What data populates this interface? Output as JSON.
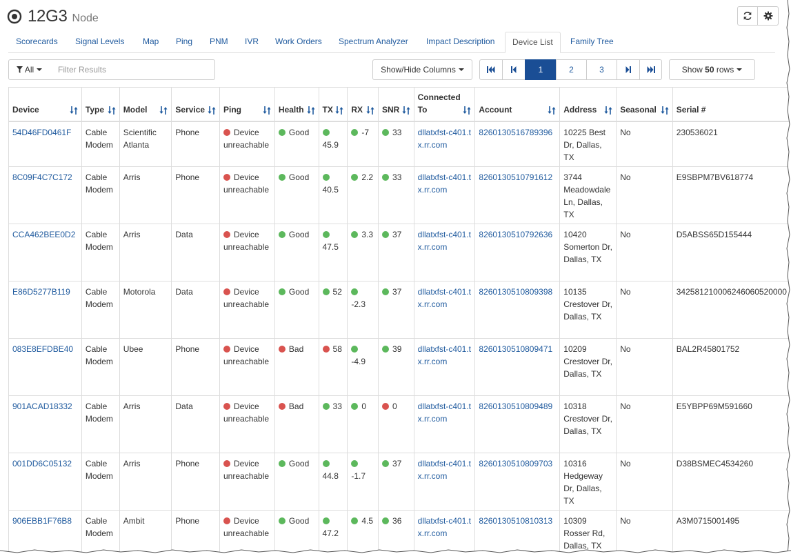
{
  "header": {
    "node_id": "12G3",
    "node_type": "Node",
    "icons": {
      "target": "target-icon",
      "refresh": "refresh-icon",
      "settings": "gear-icon"
    }
  },
  "tabs": [
    {
      "label": "Scorecards"
    },
    {
      "label": "Signal Levels"
    },
    {
      "label": "Map"
    },
    {
      "label": "Ping"
    },
    {
      "label": "PNM"
    },
    {
      "label": "IVR"
    },
    {
      "label": "Work Orders"
    },
    {
      "label": "Spectrum Analyzer"
    },
    {
      "label": "Impact Description"
    },
    {
      "label": "Device List",
      "active": true
    },
    {
      "label": "Family Tree"
    }
  ],
  "toolbar": {
    "filter_label": "All",
    "filter_placeholder": "Filter Results",
    "columns_button": "Show/Hide Columns",
    "pages": [
      "1",
      "2",
      "3"
    ],
    "current_page": "1",
    "rows_prefix": "Show",
    "rows_count": "50",
    "rows_suffix": "rows"
  },
  "table": {
    "columns": [
      "Device",
      "Type",
      "Model",
      "Service",
      "Ping",
      "Health",
      "TX",
      "RX",
      "SNR",
      "Connected To",
      "Account",
      "Address",
      "Seasonal",
      "Serial #"
    ],
    "rows": [
      {
        "device": "54D46FD0461F",
        "type": "Cable Modem",
        "model": "Scientific Atlanta",
        "service": "Phone",
        "ping": "Device unreachable",
        "health": "Good",
        "tx": "45.9",
        "rx": "-7",
        "snr": "33",
        "connected": "dllatxfst-c401.tx.rr.com",
        "account": "8260130516789396",
        "address": "10225 Best Dr, Dallas, TX",
        "seasonal": "No",
        "serial": "230536021",
        "health_status": "good",
        "tx_status": "good",
        "rx_status": "good",
        "snr_status": "good"
      },
      {
        "device": "8C09F4C7C172",
        "type": "Cable Modem",
        "model": "Arris",
        "service": "Phone",
        "ping": "Device unreachable",
        "health": "Good",
        "tx": "40.5",
        "rx": "2.2",
        "snr": "33",
        "connected": "dllatxfst-c401.tx.rr.com",
        "account": "8260130510791612",
        "address": "3744 Meadowdale Ln, Dallas, TX",
        "seasonal": "No",
        "serial": "E9SBPM7BV618774",
        "health_status": "good",
        "tx_status": "good",
        "rx_status": "good",
        "snr_status": "good"
      },
      {
        "device": "CCA462BEE0D2",
        "type": "Cable Modem",
        "model": "Arris",
        "service": "Data",
        "ping": "Device unreachable",
        "health": "Good",
        "tx": "47.5",
        "rx": "3.3",
        "snr": "37",
        "connected": "dllatxfst-c401.tx.rr.com",
        "account": "8260130510792636",
        "address": "10420 Somerton Dr, Dallas, TX",
        "seasonal": "No",
        "serial": "D5ABSS65D155444",
        "health_status": "good",
        "tx_status": "good",
        "rx_status": "good",
        "snr_status": "good"
      },
      {
        "device": "E86D5277B119",
        "type": "Cable Modem",
        "model": "Motorola",
        "service": "Data",
        "ping": "Device unreachable",
        "health": "Good",
        "tx": "52",
        "rx": "-2.3",
        "snr": "37",
        "connected": "dllatxfst-c401.tx.rr.com",
        "account": "8260130510809398",
        "address": "10135 Crestover Dr, Dallas, TX",
        "seasonal": "No",
        "serial": "342581210006246060520000",
        "health_status": "good",
        "tx_status": "good",
        "rx_status": "good",
        "snr_status": "good"
      },
      {
        "device": "083E8EFDBE40",
        "type": "Cable Modem",
        "model": "Ubee",
        "service": "Phone",
        "ping": "Device unreachable",
        "health": "Bad",
        "tx": "58",
        "rx": "-4.9",
        "snr": "39",
        "connected": "dllatxfst-c401.tx.rr.com",
        "account": "8260130510809471",
        "address": "10209 Crestover Dr, Dallas, TX",
        "seasonal": "No",
        "serial": "BAL2R45801752",
        "health_status": "bad",
        "tx_status": "bad",
        "rx_status": "good",
        "snr_status": "good"
      },
      {
        "device": "901ACAD18332",
        "type": "Cable Modem",
        "model": "Arris",
        "service": "Data",
        "ping": "Device unreachable",
        "health": "Bad",
        "tx": "33",
        "rx": "0",
        "snr": "0",
        "connected": "dllatxfst-c401.tx.rr.com",
        "account": "8260130510809489",
        "address": "10318 Crestover Dr, Dallas, TX",
        "seasonal": "No",
        "serial": "E5YBPP69M591660",
        "health_status": "bad",
        "tx_status": "good",
        "rx_status": "good",
        "snr_status": "bad"
      },
      {
        "device": "001DD6C05132",
        "type": "Cable Modem",
        "model": "Arris",
        "service": "Phone",
        "ping": "Device unreachable",
        "health": "Good",
        "tx": "44.8",
        "rx": "-1.7",
        "snr": "37",
        "connected": "dllatxfst-c401.tx.rr.com",
        "account": "8260130510809703",
        "address": "10316 Hedgeway Dr, Dallas, TX",
        "seasonal": "No",
        "serial": "D38BSMEC4534260",
        "health_status": "good",
        "tx_status": "good",
        "rx_status": "good",
        "snr_status": "good"
      },
      {
        "device": "906EBB1F76B8",
        "type": "Cable Modem",
        "model": "Ambit",
        "service": "Phone",
        "ping": "Device unreachable",
        "health": "Good",
        "tx": "47.2",
        "rx": "4.5",
        "snr": "36",
        "connected": "dllatxfst-c401.tx.rr.com",
        "account": "8260130510810313",
        "address": "10309 Rosser Rd, Dallas, TX",
        "seasonal": "No",
        "serial": "A3M0715001495",
        "health_status": "good",
        "tx_status": "good",
        "rx_status": "good",
        "snr_status": "good"
      }
    ]
  },
  "colors": {
    "good": "#5cb85c",
    "bad": "#d9534f",
    "link": "#1f5a9e",
    "active_page": "#1a4e95"
  }
}
